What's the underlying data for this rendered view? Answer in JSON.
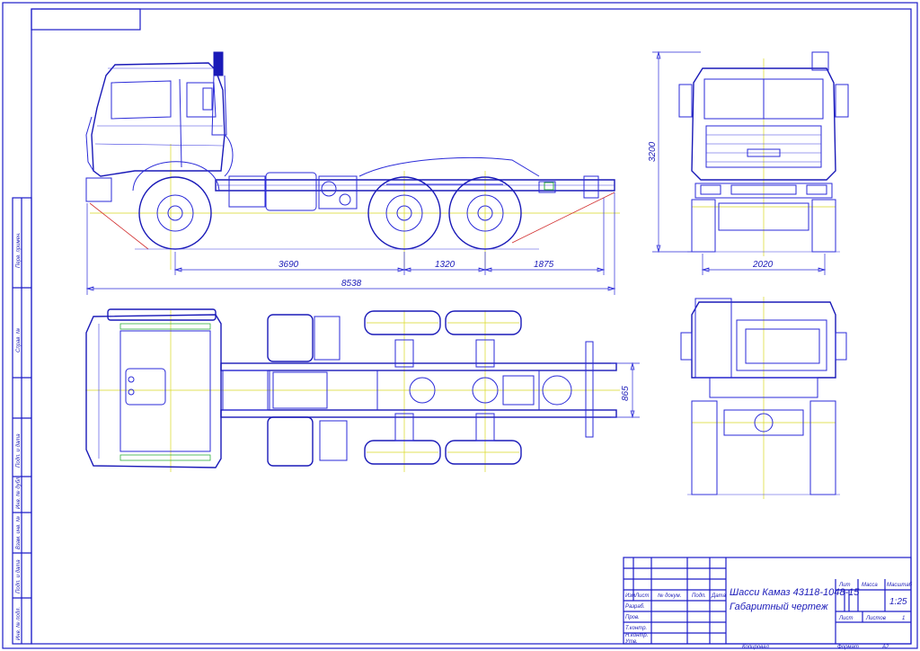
{
  "dimensions": {
    "wheelbase_front": "3690",
    "bogie": "1320",
    "rear_overhang": "1875",
    "overall_length": "8538",
    "height": "3200",
    "track_width": "2020",
    "frame_width": "865"
  },
  "title_block": {
    "drawing_name_line1": "Шасси Камаз 43118-1048-15",
    "drawing_name_line2": "Габаритный чертеж",
    "col_lit": "Лит",
    "col_mass": "Масса",
    "col_scale": "Масштаб",
    "scale_value": "1:25",
    "sheet_label": "Лист",
    "sheets_label": "Листов",
    "sheets_value": "1",
    "row_izm": "Изм",
    "row_list": "Лист",
    "row_doc": "№ докум.",
    "row_podp": "Подп.",
    "row_data": "Дата",
    "role_razrab": "Разраб.",
    "role_prov": "Пров.",
    "role_tkontr": "Т.контр.",
    "role_nkontr": "Н.контр.",
    "role_utv": "Утв.",
    "copied": "Копировал",
    "format": "Формат",
    "format_value": "А2"
  },
  "side_stamp": {
    "perv_primen": "Перв. примен.",
    "sprav_no": "Справ. №",
    "podp_data1": "Подп. и дата",
    "inv_dubl": "Инв. № дубл.",
    "vzam_inv": "Взам. инв. №",
    "podp_data2": "Подп. и дата",
    "inv_podl": "Инв. № подл."
  },
  "colors": {
    "line": "#2a2ad8",
    "center": "#d8d820",
    "accent_red": "#d23030",
    "accent_green": "#30b040",
    "exhaust": "#1a1ab8"
  }
}
